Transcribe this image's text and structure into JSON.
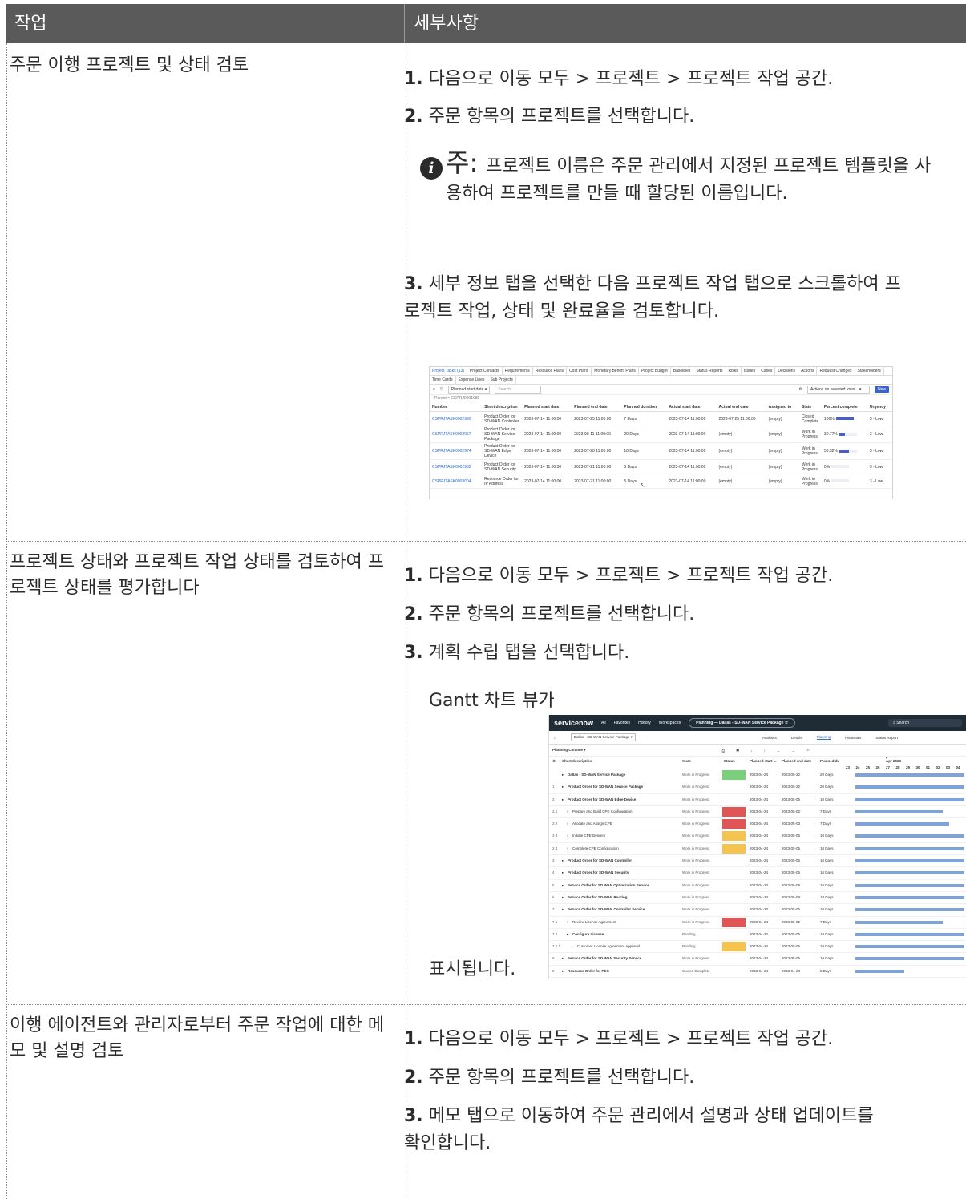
{
  "table": {
    "header": {
      "col1": "작업",
      "col2": "세부사항"
    },
    "rows": [
      {
        "task": "주문 이행 프로젝트 및 상태 검토",
        "steps": [
          {
            "num": "1.",
            "text": "다음으로 이동 모두 > 프로젝트 > 프로젝트 작업 공간."
          },
          {
            "num": "2.",
            "text": "주문 항목의 프로젝트를 선택합니다."
          },
          {
            "num": "3.",
            "text": "세부 정보 탭을 선택한 다음 프로젝트 작업 탭으로 스크롤하여 프로젝트 작업, 상태 및 완료율을 검토합니다."
          }
        ],
        "note_label": "주:",
        "note_text": "프로젝트 이름은 주문 관리에서 지정된 프로젝트 템플릿을 사용하여 프로젝트를 만들 때 할당된 이름입니다."
      },
      {
        "task": "프로젝트 상태와 프로젝트 작업 상태를 검토하여 프로젝트 상태를 평가합니다",
        "steps": [
          {
            "num": "1.",
            "text": "다음으로 이동 모두 > 프로젝트 > 프로젝트 작업 공간."
          },
          {
            "num": "2.",
            "text": "주문 항목의 프로젝트를 선택합니다."
          },
          {
            "num": "3.",
            "text": "계획 수립 탭을 선택합니다."
          }
        ],
        "caption_before": "Gantt 차트 뷰가",
        "caption_after": "표시됩니다."
      },
      {
        "task": "이행 에이전트와 관리자로부터 주문 작업에 대한 메모 및 설명 검토",
        "steps": [
          {
            "num": "1.",
            "text": "다음으로 이동 모두 > 프로젝트 > 프로젝트 작업 공간."
          },
          {
            "num": "2.",
            "text": "주문 항목의 프로젝트를 선택합니다."
          },
          {
            "num": "3.",
            "text": "메모 탭으로 이동하여 주문 관리에서 설명과 상태 업데이트를 확인합니다."
          }
        ]
      }
    ]
  },
  "screenshot_list": {
    "tabs": [
      "Project Tasks (13)",
      "Project Contacts",
      "Requirements",
      "Resource Plans",
      "Cost Plans",
      "Monetary Benefit Plans",
      "Project Budget",
      "Baselines",
      "Status Reports",
      "Risks",
      "Issues",
      "Cases",
      "Decisions",
      "Actions",
      "Request Changes",
      "Stakeholders"
    ],
    "tabs2": [
      "Time Cards",
      "Expense Lines",
      "Sub Projects"
    ],
    "filter_field": "Planned start date",
    "search_placeholder": "Search",
    "actions_select": "Actions on selected rows...",
    "new_button": "New",
    "breadcrumb": "Parent = CSPRJ0001089",
    "columns": [
      "Number",
      "Short description",
      "Planned start date",
      "Planned end date",
      "Planned duration",
      "Actual start date",
      "Actual end date",
      "Assigned to",
      "State",
      "Percent complete",
      "Urgency"
    ],
    "rows": [
      {
        "number": "CSPRJTASK0002990",
        "desc": "Product Order for SD-WAN Controller",
        "pstart": "2023-07-14 11:00:00",
        "pend": "2023-07-25 11:00:00",
        "dur": "7 Days",
        "astart": "2023-07-14 11:00:00",
        "aend": "2023-07-25 11:00:00",
        "assigned": "(empty)",
        "state": "Closed Complete",
        "pct": "100%",
        "pct_val": 1.0,
        "urgency": "3 - Low"
      },
      {
        "number": "CSPRJTASK0002967",
        "desc": "Product Order for SD-WAN Service Package",
        "pstart": "2023-07-14 11:00:00",
        "pend": "2023-08-11 11:00:00",
        "dur": "20 Days",
        "astart": "2023-07-14 11:00:00",
        "aend": "(empty)",
        "assigned": "(empty)",
        "state": "Work in Progress",
        "pct": "30.77%",
        "pct_val": 0.3077,
        "urgency": "3 - Low"
      },
      {
        "number": "CSPRJTASK0002974",
        "desc": "Product Order for SD-WAN Edge Device",
        "pstart": "2023-07-14 11:00:00",
        "pend": "2023-07-28 11:00:00",
        "dur": "10 Days",
        "astart": "2023-07-14 11:00:00",
        "aend": "(empty)",
        "assigned": "(empty)",
        "state": "Work in Progress",
        "pct": "56.52%",
        "pct_val": 0.5652,
        "urgency": "3 - Low"
      },
      {
        "number": "CSPRJTASK0002982",
        "desc": "Product Order for SD-WAN Security",
        "pstart": "2023-07-14 11:00:00",
        "pend": "2023-07-21 11:00:00",
        "dur": "5 Days",
        "astart": "2023-07-14 11:00:00",
        "aend": "(empty)",
        "assigned": "(empty)",
        "state": "Work in Progress",
        "pct": "0%",
        "pct_val": 0,
        "urgency": "3 - Low"
      },
      {
        "number": "CSPRJTASK0003004",
        "desc": "Resource Order for IP Address",
        "pstart": "2023-07-14 11:00:00",
        "pend": "2023-07-21 11:00:00",
        "dur": "5 Days",
        "astart": "2023-07-14 11:00:00",
        "aend": "(empty)",
        "assigned": "(empty)",
        "state": "Work in Progress",
        "pct": "0%",
        "pct_val": 0,
        "urgency": "3 - Low"
      }
    ]
  },
  "screenshot_gantt": {
    "logo": "servicenow",
    "nav": [
      "All",
      "Favorites",
      "History",
      "Workspaces"
    ],
    "title_pill": "Planning — Dallas - SD-WAN Service Package ☆",
    "search": "Search",
    "project_picker": "Dallas - SD-WAN Service Package",
    "tabs": [
      "Analytics",
      "Details",
      "Planning",
      "Financials",
      "Status Report"
    ],
    "console": "Planning Console",
    "columns": [
      "Short description",
      "State",
      "Status",
      "Planned start ...",
      "Planned end date",
      "Planned du"
    ],
    "month": "Apr 2023",
    "days": [
      "23",
      "24",
      "25",
      "26",
      "27",
      "28",
      "29",
      "30",
      "01",
      "02",
      "03",
      "04"
    ],
    "rows": [
      {
        "id": "",
        "desc": "Dallas - SD-WAN Service Package",
        "bold": true,
        "state": "Work in Progress",
        "status": "Green",
        "start": "2023-04-24",
        "end": "2023-05-22",
        "dur": "20 Days",
        "bar": 1.0
      },
      {
        "id": "1",
        "desc": "Product Order for SD-WAN Service Package",
        "bold": true,
        "state": "Work in Progress",
        "status": "",
        "start": "2023-04-24",
        "end": "2023-05-22",
        "dur": "20 Days",
        "bar": 1.0
      },
      {
        "id": "2",
        "desc": "Product Order for SD-WAN Edge Device",
        "bold": true,
        "state": "Work in Progress",
        "status": "",
        "start": "2023-04-24",
        "end": "2023-05-05",
        "dur": "10 Days",
        "bar": 1.0
      },
      {
        "id": "2.1",
        "desc": "Prepare and Build CPE Configuration",
        "bold": false,
        "state": "Work in Progress",
        "status": "Red",
        "start": "2023-04-24",
        "end": "2023-05-02",
        "dur": "7 Days",
        "bar": 0.8
      },
      {
        "id": "2.2",
        "desc": "Allocate and Assign CPE",
        "bold": false,
        "state": "Work in Progress",
        "status": "Red",
        "start": "2023-04-24",
        "end": "2023-05-03",
        "dur": "7 Days",
        "bar": 0.86
      },
      {
        "id": "2.3",
        "desc": "Initiate CPE Delivery",
        "bold": false,
        "state": "Work in Progress",
        "status": "Yellow",
        "start": "2023-04-24",
        "end": "2023-05-05",
        "dur": "10 Days",
        "bar": 1.0
      },
      {
        "id": "2.4",
        "desc": "Complete CPE Configuration",
        "bold": false,
        "state": "Work in Progress",
        "status": "Yellow",
        "start": "2023-04-24",
        "end": "2023-05-05",
        "dur": "10 Days",
        "bar": 1.0
      },
      {
        "id": "3",
        "desc": "Product Order for SD-WAN Controller",
        "bold": true,
        "state": "Work in Progress",
        "status": "",
        "start": "2023-04-24",
        "end": "2023-05-05",
        "dur": "10 Days",
        "bar": 1.0
      },
      {
        "id": "4",
        "desc": "Product Order for SD-WAN Security",
        "bold": true,
        "state": "Work in Progress",
        "status": "",
        "start": "2023-04-24",
        "end": "2023-05-05",
        "dur": "10 Days",
        "bar": 1.0
      },
      {
        "id": "5",
        "desc": "Service Order for SD WAN Optimization Service",
        "bold": true,
        "state": "Work in Progress",
        "status": "",
        "start": "2023-04-24",
        "end": "2023-05-08",
        "dur": "10 Days",
        "bar": 1.0
      },
      {
        "id": "6",
        "desc": "Service Order for SD-WAN Routing",
        "bold": true,
        "state": "Work in Progress",
        "status": "",
        "start": "2023-04-24",
        "end": "2023-05-08",
        "dur": "10 Days",
        "bar": 1.0
      },
      {
        "id": "7",
        "desc": "Service Order for SD-WAN Controller Service",
        "bold": true,
        "state": "Work in Progress",
        "status": "",
        "start": "2023-04-24",
        "end": "2023-05-05",
        "dur": "10 Days",
        "bar": 1.0
      },
      {
        "id": "7.1",
        "desc": "Review License Agreement",
        "bold": false,
        "state": "Work in Progress",
        "status": "Red",
        "start": "2023-04-24",
        "end": "2023-05-02",
        "dur": "7 Days",
        "bar": 0.8
      },
      {
        "id": "7.2",
        "desc": "Configure License",
        "bold": true,
        "state": "Pending",
        "status": "",
        "start": "2023-04-24",
        "end": "2023-05-05",
        "dur": "10 Days",
        "bar": 1.0
      },
      {
        "id": "7.2.1",
        "desc": "Customer License Agreement Approval",
        "bold": false,
        "state": "Pending",
        "status": "Yellow",
        "start": "2023-04-24",
        "end": "2023-05-05",
        "dur": "10 Days",
        "bar": 1.0
      },
      {
        "id": "8",
        "desc": "Service Order for SD WAN Security Service",
        "bold": true,
        "state": "Work in Progress",
        "status": "",
        "start": "2023-04-24",
        "end": "2023-05-05",
        "dur": "10 Days",
        "bar": 1.0
      },
      {
        "id": "9",
        "desc": "Resource Order for PEC",
        "bold": true,
        "state": "Closed Complete",
        "status": "",
        "start": "2023-04-24",
        "end": "2023-04-28",
        "dur": "5 Days",
        "bar": 0.45
      }
    ]
  }
}
